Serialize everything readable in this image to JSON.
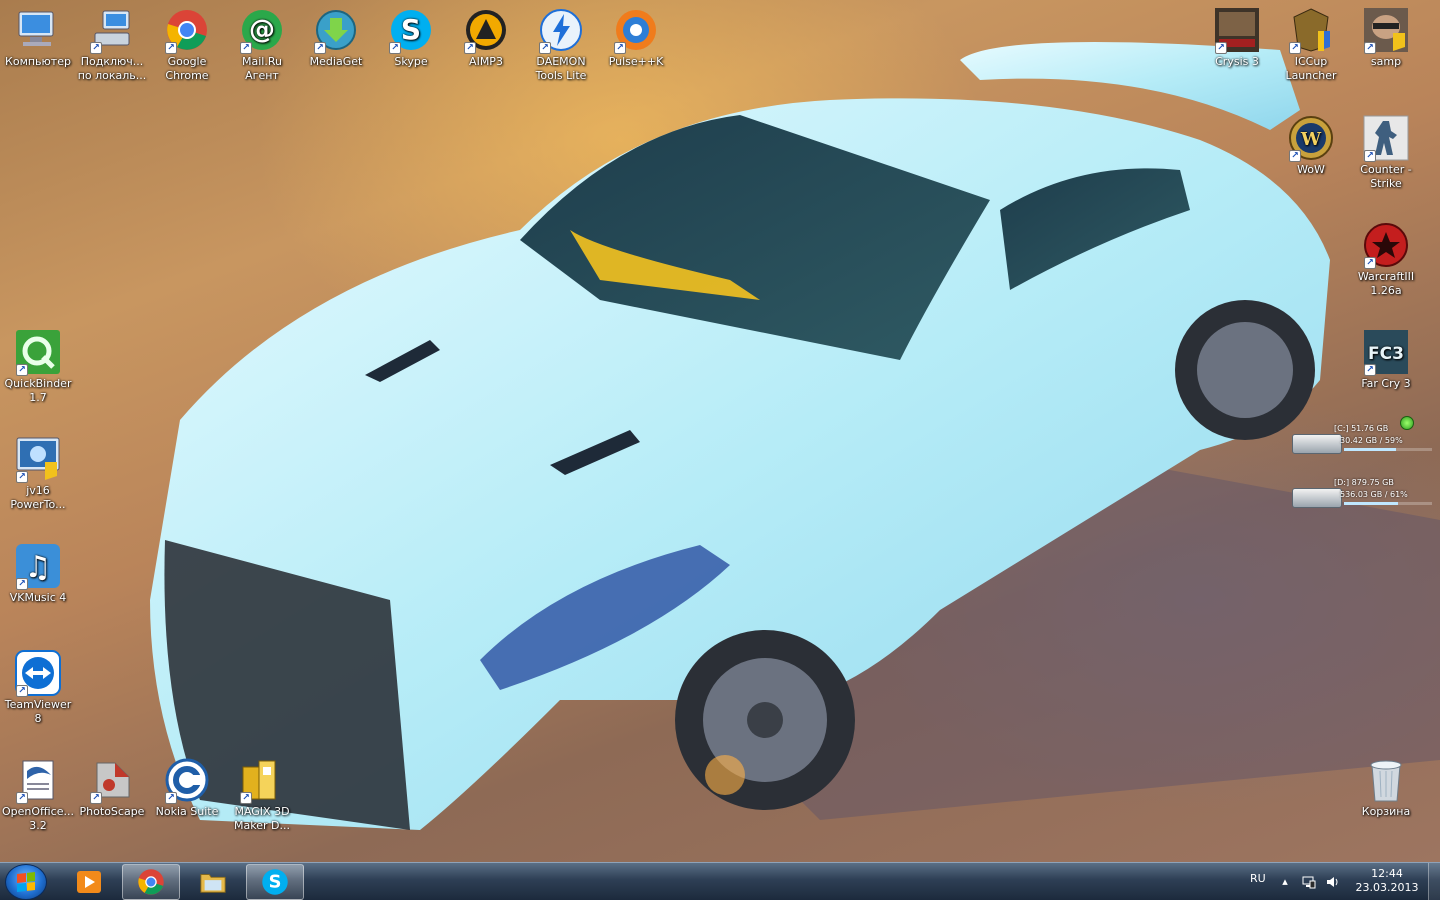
{
  "desktop": {
    "icons": [
      {
        "label": "Компьютер",
        "icon": "computer-icon",
        "color": "#4a90d9"
      },
      {
        "label": "Подключ... по локаль...",
        "icon": "network-connection-icon",
        "color": "#5b8fd6"
      },
      {
        "label": "Google Chrome",
        "icon": "chrome-icon",
        "color": "#db4437"
      },
      {
        "label": "Mail.Ru Агент",
        "icon": "mailru-agent-icon",
        "color": "#2ba84a"
      },
      {
        "label": "MediaGet",
        "icon": "mediaget-icon",
        "color": "#3aa0c9"
      },
      {
        "label": "Skype",
        "icon": "skype-icon",
        "color": "#00aff0"
      },
      {
        "label": "AIMP3",
        "icon": "aimp-icon",
        "color": "#f2a900"
      },
      {
        "label": "DAEMON Tools Lite",
        "icon": "daemon-tools-icon",
        "color": "#1e6fd9"
      },
      {
        "label": "Pulse++K",
        "icon": "pulse-icon",
        "color": "#f07c1c"
      },
      {
        "label": "Crysis 3",
        "icon": "crysis-icon",
        "color": "#5d4a3a"
      },
      {
        "label": "ICCup Launcher",
        "icon": "iccup-icon",
        "color": "#8a6a2a"
      },
      {
        "label": "samp",
        "icon": "samp-icon",
        "color": "#6b5a4c"
      },
      {
        "label": "WoW",
        "icon": "wow-icon",
        "color": "#c8a13c"
      },
      {
        "label": "Counter - Strike",
        "icon": "counter-strike-icon",
        "color": "#3f5f7f"
      },
      {
        "label": "WarcraftIII 1.26a",
        "icon": "warcraft-icon",
        "color": "#c41e1e"
      },
      {
        "label": "Far Cry 3",
        "icon": "far-cry-icon",
        "color": "#2a4a5a"
      },
      {
        "label": "QuickBinder 1.7",
        "icon": "quickbinder-icon",
        "color": "#3aa23a"
      },
      {
        "label": "jv16 PowerTo...",
        "icon": "jv16-icon",
        "color": "#2f6fb3"
      },
      {
        "label": "VKMusic 4",
        "icon": "vkmusic-icon",
        "color": "#3b8fd8"
      },
      {
        "label": "TeamViewer 8",
        "icon": "teamviewer-icon",
        "color": "#0e6fd4"
      },
      {
        "label": "OpenOffice... 3.2",
        "icon": "openoffice-icon",
        "color": "#2e63a9"
      },
      {
        "label": "PhotoScape",
        "icon": "photoscape-icon",
        "color": "#c0392b"
      },
      {
        "label": "Nokia Suite",
        "icon": "nokia-suite-icon",
        "color": "#1f5ea8"
      },
      {
        "label": "MAGIX 3D Maker D...",
        "icon": "magix-icon",
        "color": "#e2b11e"
      },
      {
        "label": "Корзина",
        "icon": "recycle-bin-icon",
        "color": "#c7d4de"
      }
    ],
    "drives": [
      {
        "name": "[C:] 51.76 GB",
        "usage": "30.42 GB / 59%",
        "used": 0.59
      },
      {
        "name": "[D:] 879.75 GB",
        "usage": "536.03 GB / 61%",
        "used": 0.61
      }
    ]
  },
  "taskbar": {
    "language": "RU",
    "time": "12:44",
    "date": "23.03.2013",
    "buttons": [
      {
        "icon": "media-player-icon",
        "color": "#f28a1a",
        "active": false
      },
      {
        "icon": "chrome-icon",
        "color": "#db4437",
        "active": true
      },
      {
        "icon": "explorer-icon",
        "color": "#e6b94a",
        "active": false
      },
      {
        "icon": "skype-icon",
        "color": "#00aff0",
        "active": true
      }
    ]
  }
}
